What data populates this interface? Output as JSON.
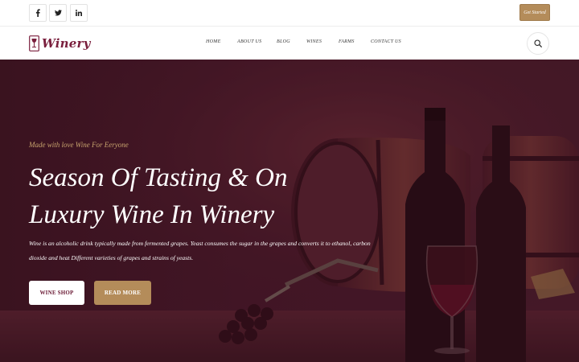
{
  "topbar": {
    "social": [
      {
        "name": "facebook-icon",
        "glyph": "f"
      },
      {
        "name": "twitter-icon",
        "glyph": "🐦"
      },
      {
        "name": "linkedin-icon",
        "glyph": "in"
      }
    ],
    "cta_label": "Get Started"
  },
  "navbar": {
    "logo_text": "Winery",
    "items": [
      "HOME",
      "ABOUT US",
      "BLOG",
      "WINES",
      "FARMS",
      "CONTACT US"
    ]
  },
  "hero": {
    "tagline": "Made with love Wine For Eeryone",
    "headline_line1": "Season Of Tasting & On",
    "headline_line2": "Luxury Wine In Winery",
    "description": "Wine is an alcoholic drink typically made from fermented grapes. Yeast consumes the sugar in the grapes and converts it to ethanol, carbon dioxide and heat Different varieties of grapes and strains of yeasts.",
    "primary_button": "WINE SHOP",
    "secondary_button": "READ MORE"
  },
  "colors": {
    "brand": "#7a1f3d",
    "accent": "#b48c5a",
    "hero_bg": "#3b1420"
  }
}
